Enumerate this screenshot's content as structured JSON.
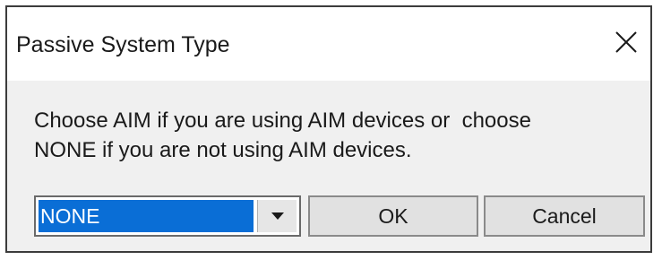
{
  "dialog": {
    "title": "Passive System Type",
    "message_line1": "Choose AIM if you are using AIM devices or  choose",
    "message_line2": "NONE if you are not using AIM devices.",
    "close_icon": "close-icon"
  },
  "system_type_select": {
    "selected_value": "NONE",
    "arrow_icon": "dropdown-arrow-icon"
  },
  "buttons": {
    "ok_label": "OK",
    "cancel_label": "Cancel"
  },
  "colors": {
    "selection_highlight": "#0a6ed6",
    "window_background": "#f0f0f0",
    "titlebar_background": "#ffffff"
  }
}
